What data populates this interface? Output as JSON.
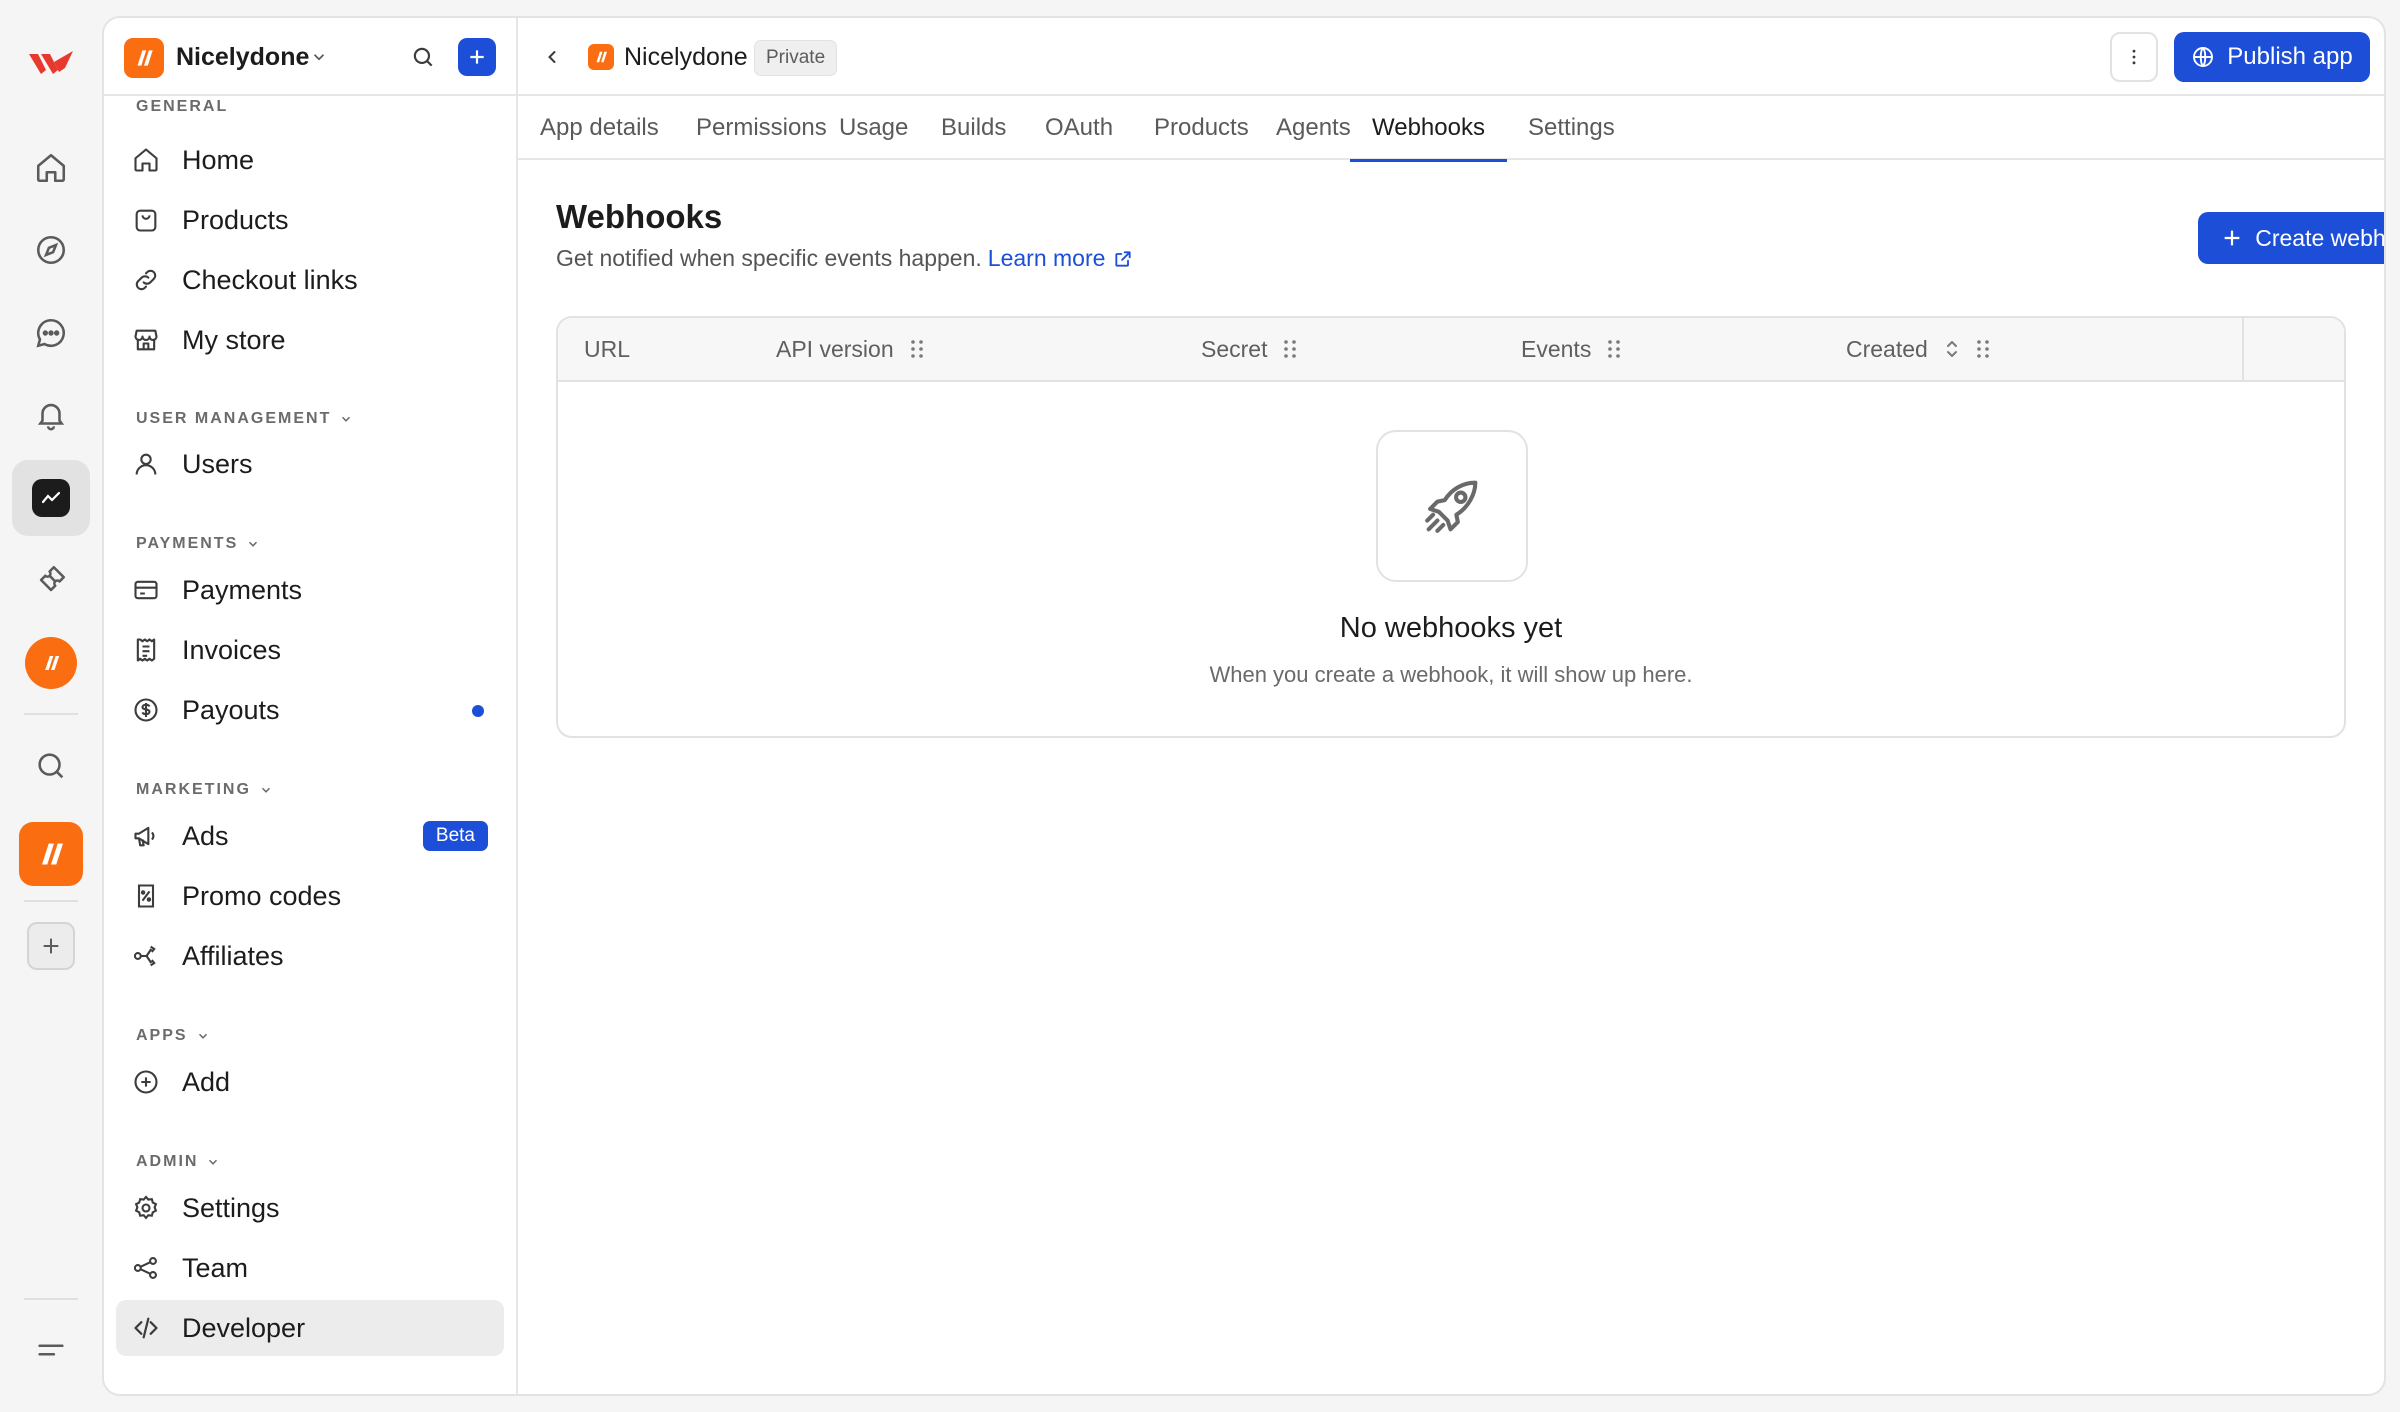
{
  "company": {
    "name": "Nicelydone"
  },
  "sidebar": {
    "sections": {
      "general": "GENERAL",
      "user_management": "USER MANAGEMENT",
      "payments": "PAYMENTS",
      "marketing": "MARKETING",
      "apps": "APPS",
      "admin": "ADMIN"
    },
    "items": {
      "home": "Home",
      "products": "Products",
      "checkout_links": "Checkout links",
      "my_store": "My store",
      "users": "Users",
      "payments": "Payments",
      "invoices": "Invoices",
      "payouts": "Payouts",
      "ads": "Ads",
      "ads_badge": "Beta",
      "promo_codes": "Promo codes",
      "affiliates": "Affiliates",
      "add": "Add",
      "settings": "Settings",
      "team": "Team",
      "developer": "Developer"
    }
  },
  "header": {
    "app_name": "Nicelydone",
    "visibility_badge": "Private",
    "publish_label": "Publish app"
  },
  "tabs": [
    {
      "label": "App details"
    },
    {
      "label": "Permissions"
    },
    {
      "label": "Usage"
    },
    {
      "label": "Builds"
    },
    {
      "label": "OAuth"
    },
    {
      "label": "Products"
    },
    {
      "label": "Agents"
    },
    {
      "label": "Webhooks",
      "active": true
    },
    {
      "label": "Settings"
    }
  ],
  "page": {
    "title": "Webhooks",
    "subtitle": "Get notified when specific events happen.",
    "learn_more": "Learn more",
    "create_label": "Create webhook"
  },
  "table": {
    "columns": [
      "URL",
      "API version",
      "Secret",
      "Events",
      "Created"
    ],
    "empty_title": "No webhooks yet",
    "empty_subtitle": "When you create a webhook, it will show up here."
  },
  "colors": {
    "accent": "#1d4ed8",
    "brand": "#fa6d10"
  }
}
